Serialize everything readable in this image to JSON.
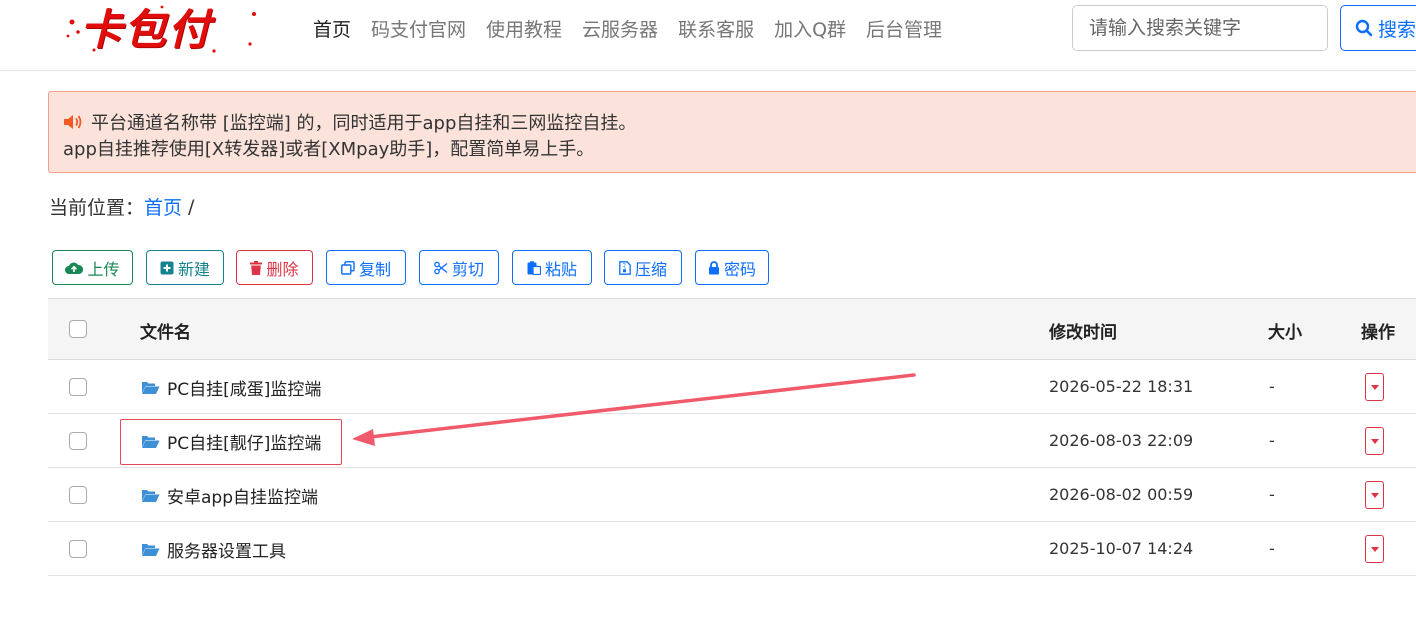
{
  "header": {
    "logo_text": "卡包付",
    "nav": [
      "首页",
      "码支付官网",
      "使用教程",
      "云服务器",
      "联系客服",
      "加入Q群",
      "后台管理"
    ],
    "search": {
      "placeholder": "请输入搜索关键字",
      "button_label": "搜索"
    }
  },
  "alert": {
    "icon": "volume-icon",
    "line1": "平台通道名称带 [监控端] 的，同时适用于app自挂和三网监控自挂。",
    "line2": "app自挂推荐使用[X转发器]或者[XMpay助手]，配置简单易上手。"
  },
  "breadcrumb": {
    "label": "当前位置：",
    "home": "首页",
    "separator": "/"
  },
  "toolbar": {
    "upload": "上传",
    "new": "新建",
    "delete": "删除",
    "copy": "复制",
    "cut": "剪切",
    "paste": "粘贴",
    "compress": "压缩",
    "password": "密码"
  },
  "table": {
    "headers": {
      "name": "文件名",
      "mtime": "修改时间",
      "size": "大小",
      "action": "操作"
    },
    "rows": [
      {
        "name": "PC自挂[咸蛋]监控端",
        "mtime": "2026-05-22 18:31",
        "size": "-"
      },
      {
        "name": "PC自挂[靓仔]监控端",
        "mtime": "2026-08-03 22:09",
        "size": "-"
      },
      {
        "name": "安卓app自挂监控端",
        "mtime": "2026-08-02 00:59",
        "size": "-"
      },
      {
        "name": "服务器设置工具",
        "mtime": "2025-10-07 14:24",
        "size": "-"
      }
    ]
  },
  "colors": {
    "primary": "#0d6efd",
    "danger": "#dc3545",
    "success": "#198754",
    "info": "#14838f",
    "alert_bg": "#fbe3db",
    "annotation": "#e8475a"
  }
}
